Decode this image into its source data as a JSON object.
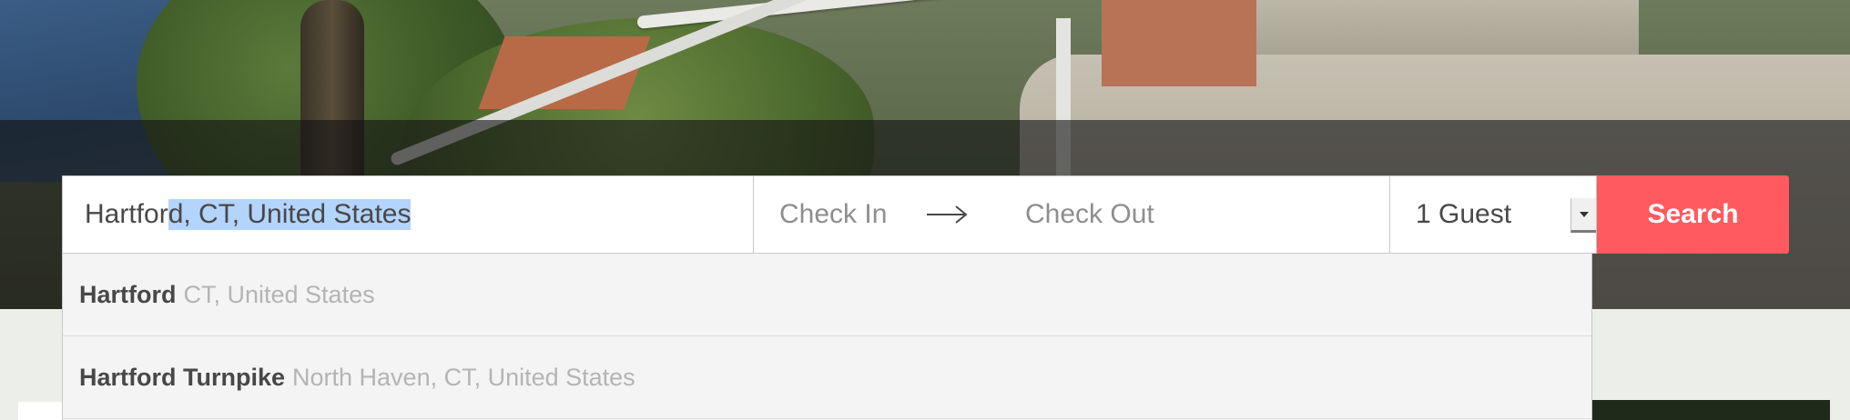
{
  "search": {
    "location_typed": "Hartfor",
    "location_autofill": "d, CT, United States",
    "check_in_placeholder": "Check In",
    "check_out_placeholder": "Check Out",
    "guests_selected": "1 Guest",
    "search_label": "Search"
  },
  "suggestions": [
    {
      "primary": "Hartford",
      "secondary": "CT, United States"
    },
    {
      "primary": "Hartford Turnpike",
      "secondary": "North Haven, CT, United States"
    }
  ],
  "icons": {
    "dates_arrow": "right-arrow-icon",
    "guests_dropdown": "chevron-down-icon"
  },
  "colors": {
    "search_button": "#ff5a5f",
    "selection_highlight": "#b3d4fc"
  }
}
